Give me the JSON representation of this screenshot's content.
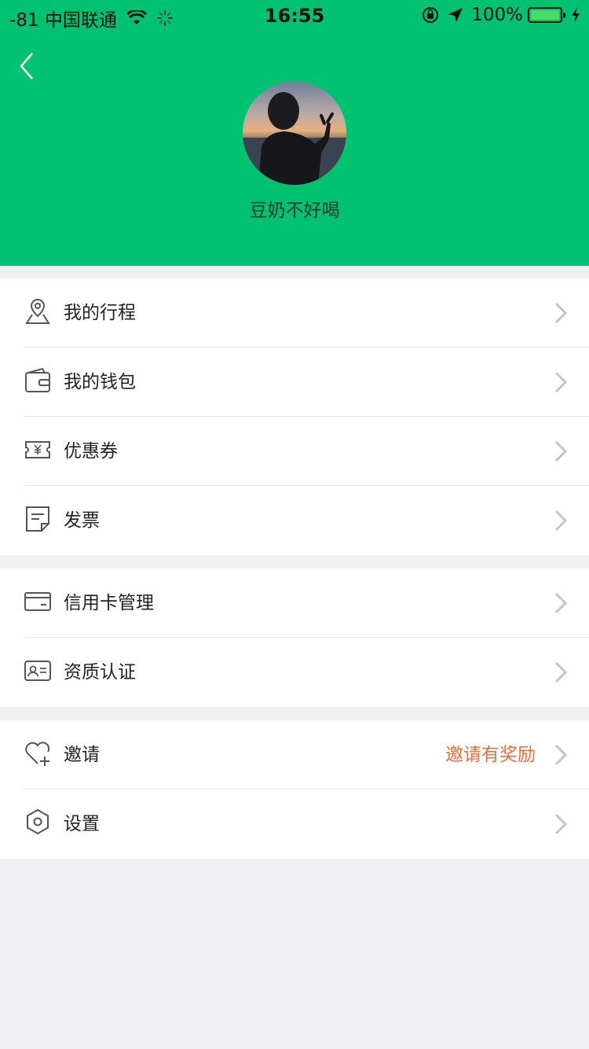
{
  "status_bar": {
    "carrier": "-81 中国联通",
    "time": "16:55",
    "battery": "100%",
    "battery_level": 1.0
  },
  "profile": {
    "username": "豆奶不好喝"
  },
  "menu_group_1": [
    {
      "label": "我的行程",
      "icon": "location-pin-icon"
    },
    {
      "label": "我的钱包",
      "icon": "wallet-icon"
    },
    {
      "label": "优惠券",
      "icon": "coupon-icon"
    },
    {
      "label": "发票",
      "icon": "invoice-icon"
    }
  ],
  "menu_group_2": [
    {
      "label": "信用卡管理",
      "icon": "credit-card-icon"
    },
    {
      "label": "资质认证",
      "icon": "id-card-icon"
    }
  ],
  "menu_group_3": [
    {
      "label": "邀请",
      "extra": "邀请有奖励",
      "icon": "heart-plus-icon"
    },
    {
      "label": "设置",
      "icon": "settings-icon"
    }
  ],
  "colors": {
    "header_green": "#00c271",
    "background": "#efeff4",
    "accent_orange": "#f26b3a"
  }
}
